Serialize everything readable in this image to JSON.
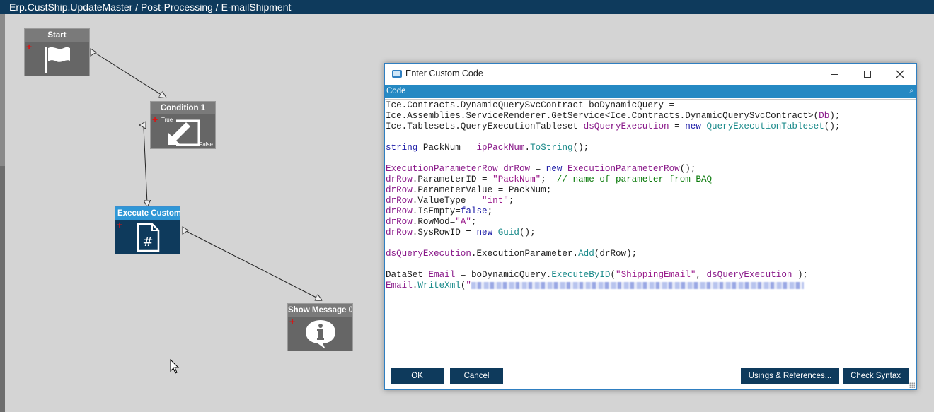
{
  "titlebar": {
    "path": "Erp.CustShip.UpdateMaster / Post-Processing / E-mailShipment"
  },
  "workflow": {
    "nodes": [
      {
        "id": "start",
        "label": "Start",
        "icon": "flag-icon"
      },
      {
        "id": "condition",
        "label": "Condition 1",
        "icon": "condition-arrows-icon",
        "true_label": "True",
        "false_label": "False"
      },
      {
        "id": "execute",
        "label": "Execute Custom Code",
        "icon": "code-file-icon",
        "selected": true
      },
      {
        "id": "message",
        "label": "Show Message 0",
        "icon": "info-bubble-icon"
      }
    ]
  },
  "dialog": {
    "title": "Enter Custom Code",
    "section_label": "Code",
    "window_controls": {
      "minimize": "minimize-icon",
      "maximize": "maximize-icon",
      "close": "close-icon"
    },
    "code_lines": [
      [
        [
          "",
          "Ice.Contracts.DynamicQuerySvcContract boDynamicQuery ="
        ]
      ],
      [
        [
          "",
          "Ice.Assemblies.ServiceRenderer.GetService<Ice.Contracts.DynamicQuerySvcContract>("
        ],
        [
          "ty",
          "Db"
        ],
        [
          "",
          ");"
        ]
      ],
      [
        [
          "",
          "Ice.Tablesets.QueryExecutionTableset "
        ],
        [
          "ty",
          "dsQueryExecution"
        ],
        [
          "",
          " = "
        ],
        [
          "kw",
          "new"
        ],
        [
          "",
          " "
        ],
        [
          "mt",
          "QueryExecutionTableset"
        ],
        [
          "",
          "();"
        ]
      ],
      [],
      [
        [
          "kw",
          "string"
        ],
        [
          "",
          " PackNum = "
        ],
        [
          "ty",
          "ipPackNum"
        ],
        [
          "",
          "."
        ],
        [
          "mt",
          "ToString"
        ],
        [
          "",
          "();"
        ]
      ],
      [],
      [
        [
          "ty",
          "ExecutionParameterRow"
        ],
        [
          "",
          " "
        ],
        [
          "ty",
          "drRow"
        ],
        [
          "",
          " = "
        ],
        [
          "kw",
          "new"
        ],
        [
          "",
          " "
        ],
        [
          "ty",
          "ExecutionParameterRow"
        ],
        [
          "",
          "();"
        ]
      ],
      [
        [
          "ty",
          "drRow"
        ],
        [
          "",
          ".ParameterID = "
        ],
        [
          "str",
          "\"PackNum\""
        ],
        [
          "",
          ";  "
        ],
        [
          "cm",
          "// name of parameter from BAQ"
        ]
      ],
      [
        [
          "ty",
          "drRow"
        ],
        [
          "",
          ".ParameterValue = PackNum;"
        ]
      ],
      [
        [
          "ty",
          "drRow"
        ],
        [
          "",
          ".ValueType = "
        ],
        [
          "str",
          "\"int\""
        ],
        [
          "",
          ";"
        ]
      ],
      [
        [
          "ty",
          "drRow"
        ],
        [
          "",
          ".IsEmpty="
        ],
        [
          "kw",
          "false"
        ],
        [
          "",
          ";"
        ]
      ],
      [
        [
          "ty",
          "drRow"
        ],
        [
          "",
          ".RowMod="
        ],
        [
          "str",
          "\"A\""
        ],
        [
          "",
          ";"
        ]
      ],
      [
        [
          "ty",
          "drRow"
        ],
        [
          "",
          ".SysRowID = "
        ],
        [
          "kw",
          "new"
        ],
        [
          "",
          " "
        ],
        [
          "mt",
          "Guid"
        ],
        [
          "",
          "();"
        ]
      ],
      [],
      [
        [
          "ty",
          "dsQueryExecution"
        ],
        [
          "",
          ".ExecutionParameter."
        ],
        [
          "mt",
          "Add"
        ],
        [
          "",
          "(drRow);"
        ]
      ],
      [],
      [
        [
          "",
          "DataSet "
        ],
        [
          "ty",
          "Email"
        ],
        [
          "",
          " = boDynamicQuery."
        ],
        [
          "mt",
          "ExecuteByID"
        ],
        [
          "",
          "("
        ],
        [
          "str",
          "\"ShippingEmail\""
        ],
        [
          "",
          ", "
        ],
        [
          "ty",
          "dsQueryExecution"
        ],
        [
          "",
          " );"
        ]
      ],
      [
        [
          "ty",
          "Email"
        ],
        [
          "",
          "."
        ],
        [
          "mt",
          "WriteXml"
        ],
        [
          "",
          "("
        ],
        [
          "str",
          "\""
        ],
        [
          "blur",
          ""
        ]
      ]
    ],
    "buttons": {
      "ok": "OK",
      "cancel": "Cancel",
      "usings": "Usings & References...",
      "check": "Check Syntax"
    }
  },
  "colors": {
    "titlebar": "#0e3a5c",
    "accent": "#2589c3",
    "button": "#0e3a5c",
    "canvas": "#d4d4d4"
  }
}
